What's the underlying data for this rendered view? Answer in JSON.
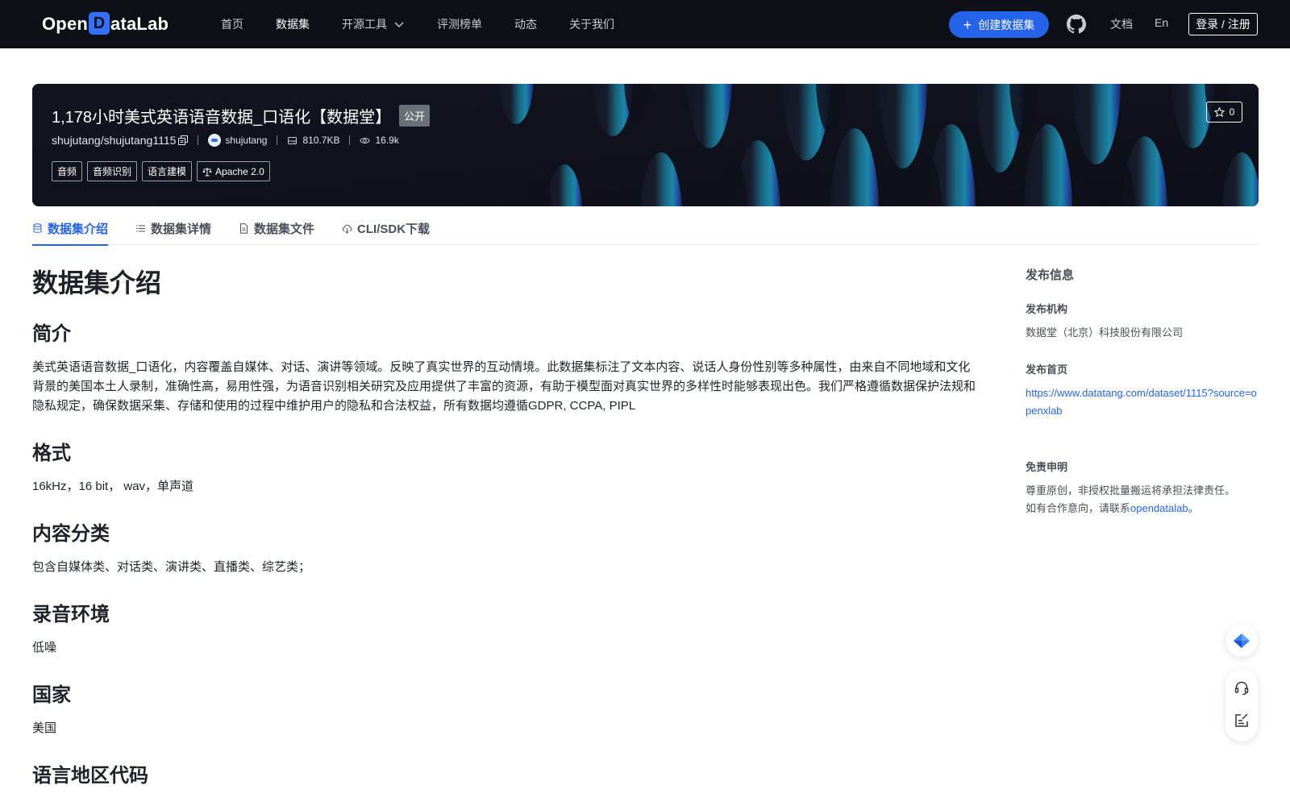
{
  "nav": {
    "logo_pre": "Open",
    "logo_d": "D",
    "logo_post": "ataLab",
    "links": [
      "首页",
      "数据集",
      "开源工具",
      "评测榜单",
      "动态",
      "关于我们"
    ],
    "create_label": "创建数据集",
    "docs_label": "文档",
    "lang_label": "En",
    "login_label": "登录 / 注册"
  },
  "hero": {
    "title": "1,178小时美式英语语音数据_口语化【数据堂】",
    "visibility": "公开",
    "path": "shujutang/shujutang1115",
    "owner": "shujutang",
    "size": "810.7KB",
    "views": "16.9k",
    "tags": [
      "音频",
      "音频识别",
      "语言建模"
    ],
    "license": "Apache 2.0",
    "stars": "0"
  },
  "tabs": [
    "数据集介绍",
    "数据集详情",
    "数据集文件",
    "CLI/SDK下载"
  ],
  "content": {
    "page_title": "数据集介绍",
    "sections": [
      {
        "heading": "简介",
        "body": "美式英语语音数据_口语化，内容覆盖自媒体、对话、演讲等领域。反映了真实世界的互动情境。此数据集标注了文本内容、说话人身份性别等多种属性，由来自不同地域和文化背景的美国本土人录制，准确性高，易用性强，为语音识别相关研究及应用提供了丰富的资源，有助于模型面对真实世界的多样性时能够表现出色。我们严格遵循数据保护法规和隐私规定，确保数据采集、存储和使用的过程中维护用户的隐私和合法权益，所有数据均遵循GDPR, CCPA, PIPL"
      },
      {
        "heading": "格式",
        "body": "16kHz，16 bit， wav，单声道"
      },
      {
        "heading": "内容分类",
        "body": "包含自媒体类、对话类、演讲类、直播类、综艺类；"
      },
      {
        "heading": "录音环境",
        "body": "低噪"
      },
      {
        "heading": "国家",
        "body": "美国"
      },
      {
        "heading": "语言地区代码",
        "body": ""
      }
    ]
  },
  "sidebar": {
    "title": "发布信息",
    "org_label": "发布机构",
    "org_value": "数据堂（北京）科技股份有限公司",
    "home_label": "发布首页",
    "home_url": "https://www.datatang.com/dataset/1115?source=openxlab",
    "disclaimer_label": "免责申明",
    "disclaimer_line1": "尊重原创，非授权批量搬运将承担法律责任。",
    "disclaimer_line2_pre": "如有合作意向，请联系",
    "disclaimer_link": "opendatalab",
    "disclaimer_line2_post": "。"
  },
  "colors": {
    "nav_bg": "#0d1117",
    "accent": "#2563eb",
    "hero_bg": "#0f111a"
  }
}
